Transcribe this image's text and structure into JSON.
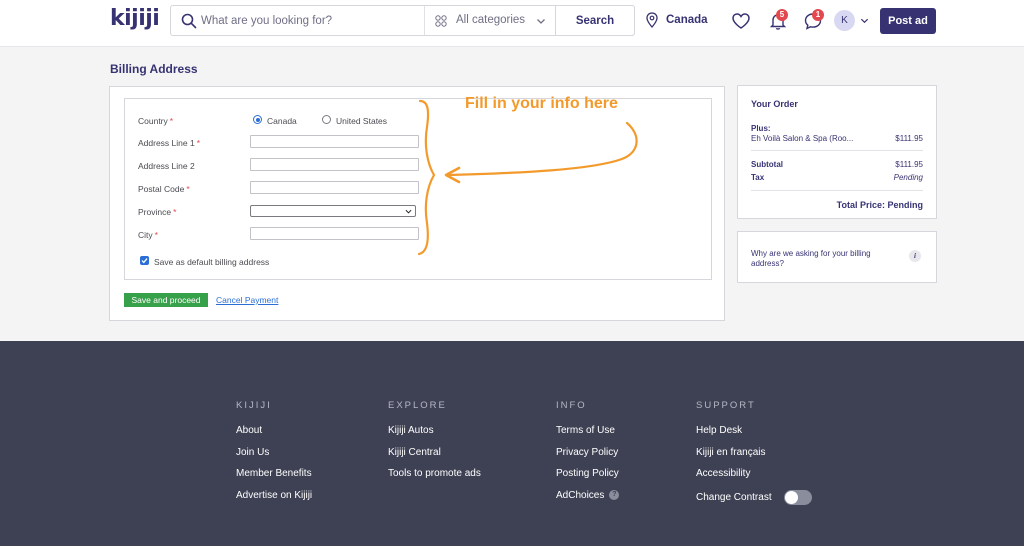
{
  "header": {
    "logo": "kijiji",
    "search_placeholder": "What are you looking for?",
    "category": "All categories",
    "search_button": "Search",
    "location": "Canada",
    "notifications_count": "5",
    "messages_count": "1",
    "avatar_initial": "K",
    "post_ad": "Post ad",
    "icons": [
      "search-icon",
      "grid-icon",
      "location-pin-icon",
      "heart-icon",
      "bell-icon",
      "chat-icon",
      "chevron-down-icon"
    ]
  },
  "page": {
    "title": "Billing Address"
  },
  "form": {
    "country_label": "Country",
    "country_options": [
      "Canada",
      "United States"
    ],
    "country_selected": "Canada",
    "address1_label": "Address Line 1",
    "address2_label": "Address Line 2",
    "postal_label": "Postal Code",
    "province_label": "Province",
    "city_label": "City",
    "required_mark": "*",
    "save_default_label": "Save as default billing address",
    "save_default_checked": true,
    "save_button": "Save and proceed",
    "cancel_link": "Cancel Payment"
  },
  "annotation": {
    "text": "Fill in your info here",
    "color": "#f39a2c"
  },
  "order": {
    "title": "Your Order",
    "plus_label": "Plus:",
    "item_name": "Eh Voilà Salon & Spa (Roo...",
    "item_price": "$111.95",
    "subtotal_label": "Subtotal",
    "subtotal_value": "$111.95",
    "tax_label": "Tax",
    "tax_value": "Pending",
    "total": "Total Price: Pending",
    "why_text": "Why are we asking for your billing address?",
    "info_icon": "i"
  },
  "footer": {
    "columns": [
      {
        "heading": "KIJIJI",
        "links": [
          "About",
          "Join Us",
          "Member Benefits",
          "Advertise on Kijiji"
        ]
      },
      {
        "heading": "EXPLORE",
        "links": [
          "Kijiji Autos",
          "Kijiji Central",
          "Tools to promote ads"
        ]
      },
      {
        "heading": "INFO",
        "links": [
          "Terms of Use",
          "Privacy Policy",
          "Posting Policy",
          "AdChoices"
        ]
      },
      {
        "heading": "SUPPORT",
        "links": [
          "Help Desk",
          "Kijiji en français",
          "Accessibility",
          "Change Contrast"
        ]
      }
    ],
    "adchoices_icon": "?",
    "contrast_toggle_on": false
  },
  "colors": {
    "brand": "#373373",
    "footer_bg": "#3e4153",
    "save_green": "#37a04a",
    "link_blue": "#2b6fd6",
    "badge_red": "#e2484d"
  }
}
